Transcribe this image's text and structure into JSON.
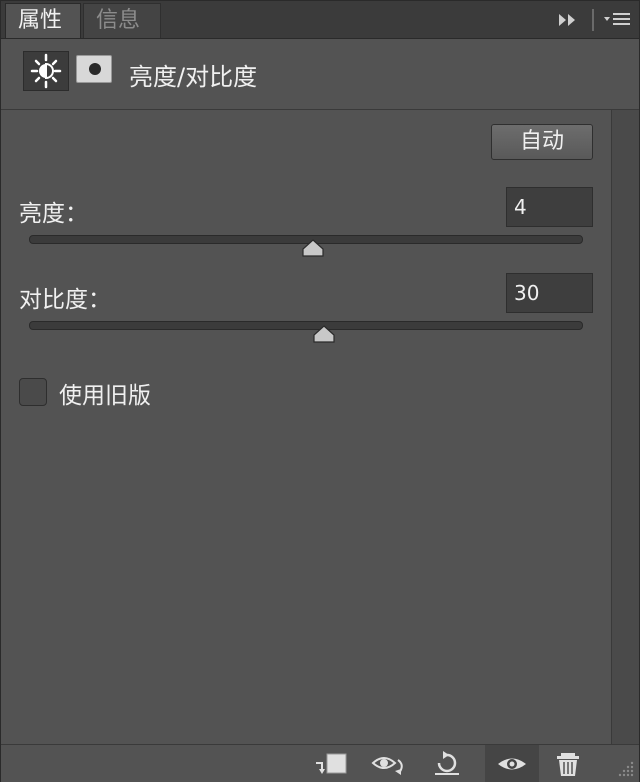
{
  "tabs": [
    {
      "label": "属性",
      "active": true
    },
    {
      "label": "信息",
      "active": false
    }
  ],
  "header": {
    "title": "亮度/对比度",
    "adjustment_icon": "sun-icon",
    "mask_icon": "layer-mask-icon"
  },
  "auto_button": {
    "label": "自动"
  },
  "brightness": {
    "label": "亮度：",
    "value": "4",
    "min": -150,
    "max": 150
  },
  "contrast": {
    "label": "对比度：",
    "value": "30",
    "min": -50,
    "max": 100
  },
  "legacy": {
    "label": "使用旧版",
    "checked": false
  },
  "toolbar": {
    "icons": [
      "clip-to-layer-icon",
      "view-previous-state-icon",
      "reset-icon",
      "visibility-eye-icon",
      "trash-icon"
    ]
  },
  "colors": {
    "panel_bg": "#535353",
    "tabbar_bg": "#3b3b3b",
    "input_bg": "#3e3e3e",
    "text": "#f0f0f0"
  }
}
